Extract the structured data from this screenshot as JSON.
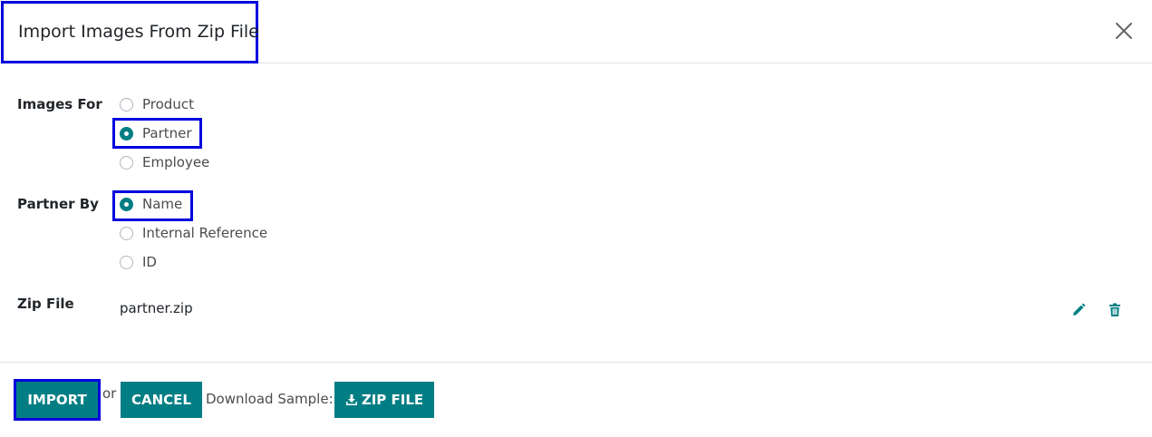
{
  "dialog": {
    "title": "Import Images From Zip File",
    "close_icon": "close-icon"
  },
  "images_for": {
    "label": "Images For",
    "options": [
      {
        "label": "Product",
        "checked": false
      },
      {
        "label": "Partner",
        "checked": true
      },
      {
        "label": "Employee",
        "checked": false
      }
    ]
  },
  "partner_by": {
    "label": "Partner By",
    "options": [
      {
        "label": "Name",
        "checked": true
      },
      {
        "label": "Internal Reference",
        "checked": false
      },
      {
        "label": "ID",
        "checked": false
      }
    ]
  },
  "zip_file": {
    "label": "Zip File",
    "value": "partner.zip",
    "edit_icon": "pencil-icon",
    "delete_icon": "trash-icon"
  },
  "footer": {
    "import_label": "IMPORT",
    "or_text": "or",
    "cancel_label": "CANCEL",
    "download_text": "Download Sample:",
    "zip_button_label": "ZIP FILE",
    "zip_button_icon": "download-icon"
  },
  "colors": {
    "accent": "#017e84",
    "highlight": "#0000dd"
  }
}
